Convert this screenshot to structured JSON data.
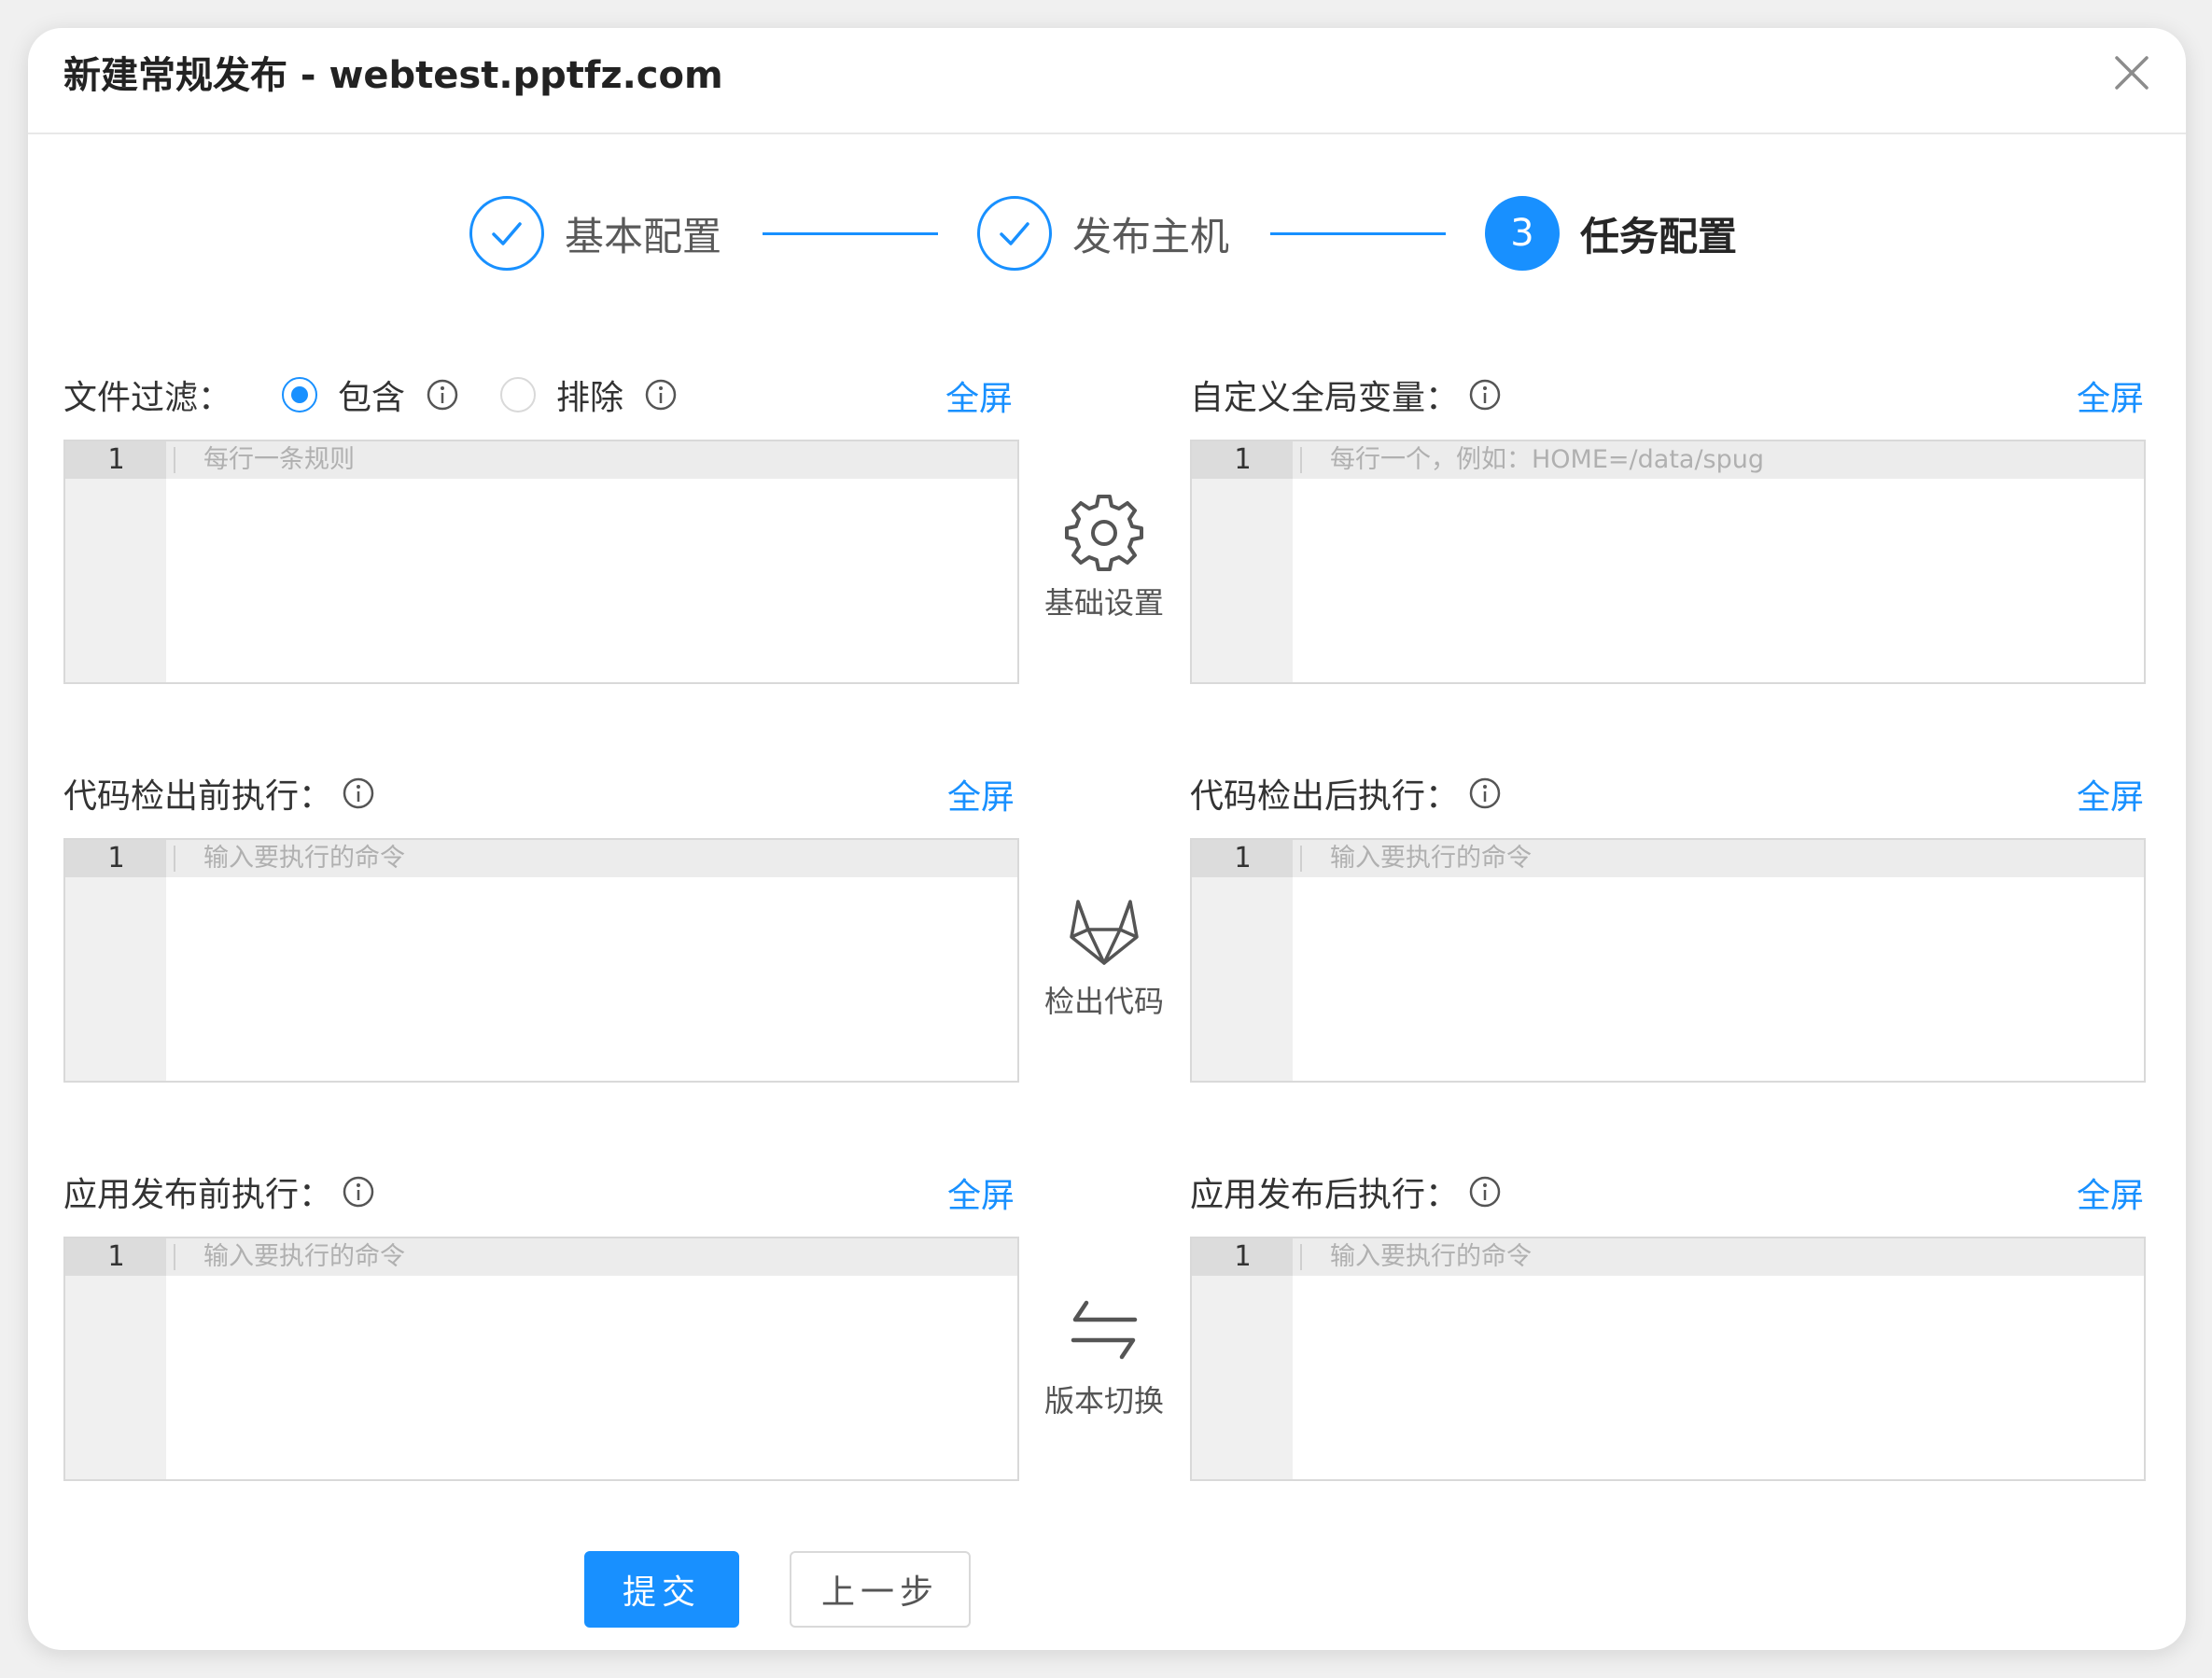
{
  "modal": {
    "title": "新建常规发布 - webtest.pptfz.com"
  },
  "steps": [
    {
      "label": "基本配置",
      "status": "done"
    },
    {
      "label": "发布主机",
      "status": "done"
    },
    {
      "label": "任务配置",
      "status": "active",
      "number": "3"
    }
  ],
  "fullscreen_label": "全屏",
  "line_number": "1",
  "file_filter": {
    "label": "文件过滤：",
    "options": [
      {
        "label": "包含",
        "checked": true
      },
      {
        "label": "排除",
        "checked": false
      }
    ],
    "placeholder": "每行一条规则"
  },
  "global_vars": {
    "label": "自定义全局变量：",
    "placeholder": "每行一个，例如：HOME=/data/spug"
  },
  "pre_checkout": {
    "label": "代码检出前执行：",
    "placeholder": "输入要执行的命令"
  },
  "post_checkout": {
    "label": "代码检出后执行：",
    "placeholder": "输入要执行的命令"
  },
  "pre_deploy": {
    "label": "应用发布前执行：",
    "placeholder": "输入要执行的命令"
  },
  "post_deploy": {
    "label": "应用发布后执行：",
    "placeholder": "输入要执行的命令"
  },
  "middle_actions": [
    {
      "label": "基础设置",
      "icon": "gear-icon"
    },
    {
      "label": "检出代码",
      "icon": "gitlab-icon"
    },
    {
      "label": "版本切换",
      "icon": "swap-icon"
    }
  ],
  "buttons": {
    "submit": "提交",
    "previous": "上一步"
  },
  "colors": {
    "primary": "#1890ff",
    "border": "#d9d9d9",
    "gutter": "#f0f0f0"
  }
}
